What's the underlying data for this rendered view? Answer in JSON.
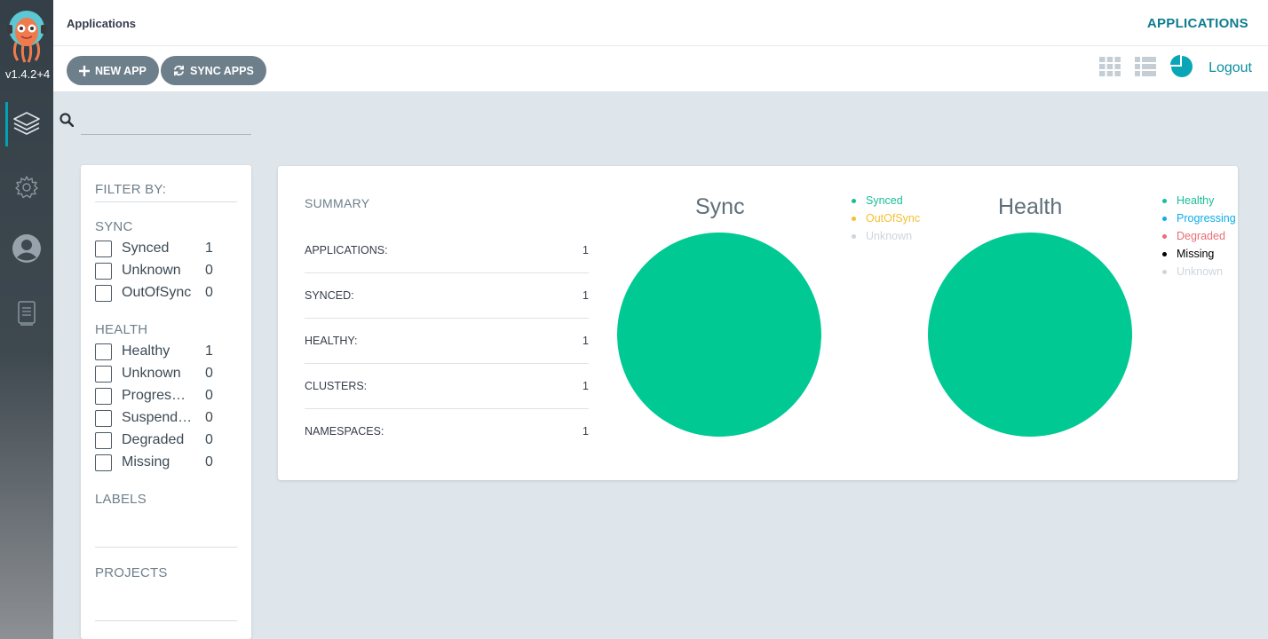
{
  "app": {
    "version": "v1.4.2+4",
    "breadcrumb": "Applications",
    "title": "APPLICATIONS"
  },
  "nav": {
    "items": [
      "layers-icon",
      "gear-icon",
      "user-icon",
      "docs-icon"
    ]
  },
  "toolbar": {
    "new_app": "NEW APP",
    "sync_apps": "SYNC APPS",
    "logout": "Logout"
  },
  "search": {
    "value": "",
    "placeholder": ""
  },
  "filters": {
    "heading": "FILTER BY:",
    "sync": {
      "label": "SYNC",
      "items": [
        {
          "label": "Synced",
          "count": "1"
        },
        {
          "label": "Unknown",
          "count": "0"
        },
        {
          "label": "OutOfSync",
          "count": "0"
        }
      ]
    },
    "health": {
      "label": "HEALTH",
      "items": [
        {
          "label": "Healthy",
          "count": "1"
        },
        {
          "label": "Unknown",
          "count": "0"
        },
        {
          "label": "Progressing",
          "count": "0"
        },
        {
          "label": "Suspended",
          "count": "0"
        },
        {
          "label": "Degraded",
          "count": "0"
        },
        {
          "label": "Missing",
          "count": "0"
        }
      ]
    },
    "labels": "LABELS",
    "projects": "PROJECTS"
  },
  "summary": {
    "title": "SUMMARY",
    "rows": [
      {
        "key": "APPLICATIONS:",
        "value": "1"
      },
      {
        "key": "SYNCED:",
        "value": "1"
      },
      {
        "key": "HEALTHY:",
        "value": "1"
      },
      {
        "key": "CLUSTERS:",
        "value": "1"
      },
      {
        "key": "NAMESPACES:",
        "value": "1"
      }
    ]
  },
  "charts": {
    "sync": {
      "title": "Sync",
      "color": "#00c994",
      "legend": [
        {
          "label": "Synced",
          "color": "#18be94"
        },
        {
          "label": "OutOfSync",
          "color": "#f4c030"
        },
        {
          "label": "Unknown",
          "color": "#ccd6dd"
        }
      ]
    },
    "health": {
      "title": "Health",
      "color": "#00c994",
      "legend": [
        {
          "label": "Healthy",
          "color": "#18be94"
        },
        {
          "label": "Progressing",
          "color": "#0dadea"
        },
        {
          "label": "Degraded",
          "color": "#e96d76"
        },
        {
          "label": "Missing",
          "color": "#000000"
        },
        {
          "label": "Unknown",
          "color": "#ccd6dd"
        }
      ]
    }
  }
}
